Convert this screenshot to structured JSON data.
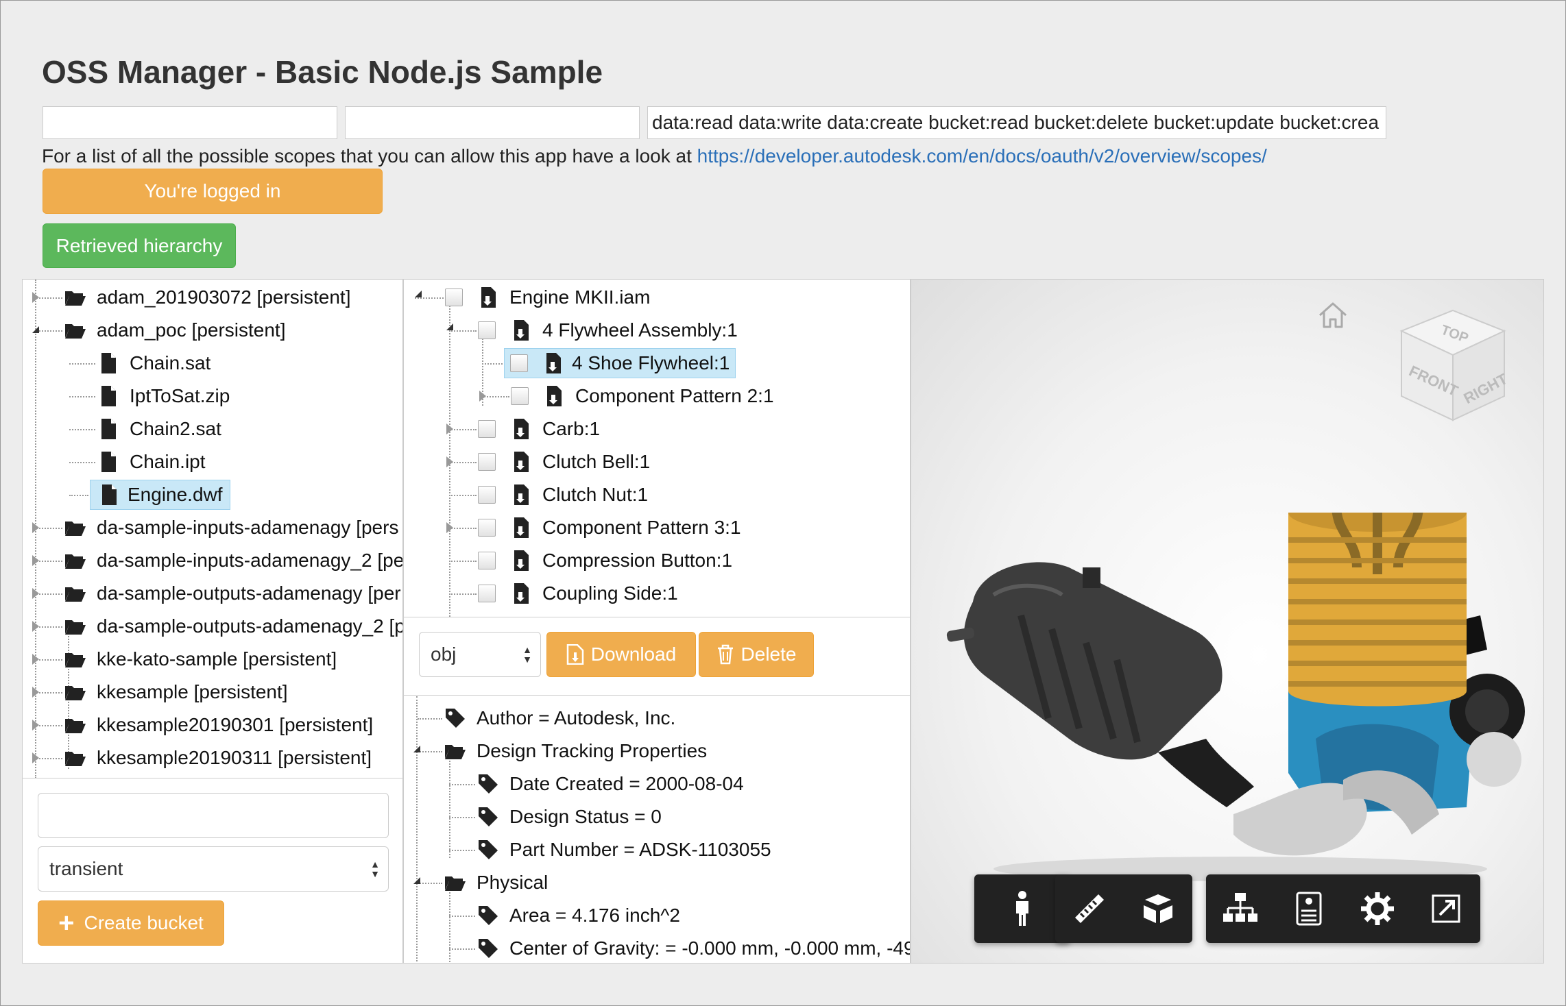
{
  "header": {
    "title": "OSS Manager - Basic Node.js Sample",
    "client_id": "",
    "client_secret": "",
    "scopes": "data:read data:write data:create bucket:read bucket:delete bucket:update bucket:crea",
    "scopes_note": "For a list of all the possible scopes that you can allow this app have a look at ",
    "scopes_link": "https://developer.autodesk.com/en/docs/oauth/v2/overview/scopes/",
    "login_label": "You're logged in",
    "hierarchy_label": "Retrieved hierarchy"
  },
  "buckets": {
    "items": [
      {
        "label": "adam_201903072 [persistent]"
      },
      {
        "label": "adam_poc [persistent]"
      },
      {
        "label": "Chain.sat"
      },
      {
        "label": "IptToSat.zip"
      },
      {
        "label": "Chain2.sat"
      },
      {
        "label": "Chain.ipt"
      },
      {
        "label": "Engine.dwf"
      },
      {
        "label": "da-sample-inputs-adamenagy [pers"
      },
      {
        "label": "da-sample-inputs-adamenagy_2 [pe"
      },
      {
        "label": "da-sample-outputs-adamenagy [per"
      },
      {
        "label": "da-sample-outputs-adamenagy_2 [p"
      },
      {
        "label": "kke-kato-sample [persistent]"
      },
      {
        "label": "kkesample [persistent]"
      },
      {
        "label": "kkesample20190301 [persistent]"
      },
      {
        "label": "kkesample20190311 [persistent]"
      }
    ],
    "new_bucket_name": "",
    "policy_value": "transient",
    "create_label": "Create bucket"
  },
  "hierarchy": {
    "items": [
      {
        "label": "Engine MKII.iam"
      },
      {
        "label": "4 Flywheel Assembly:1"
      },
      {
        "label": "4 Shoe Flywheel:1"
      },
      {
        "label": "Component Pattern 2:1"
      },
      {
        "label": "Carb:1"
      },
      {
        "label": "Clutch Bell:1"
      },
      {
        "label": "Clutch Nut:1"
      },
      {
        "label": "Component Pattern 3:1"
      },
      {
        "label": "Compression Button:1"
      },
      {
        "label": "Coupling Side:1"
      }
    ],
    "format_value": "obj",
    "download_label": "Download",
    "delete_label": "Delete"
  },
  "properties": {
    "items": [
      {
        "label": "Author = Autodesk, Inc."
      },
      {
        "label": "Design Tracking Properties"
      },
      {
        "label": "Date Created = 2000-08-04"
      },
      {
        "label": "Design Status = 0"
      },
      {
        "label": "Part Number = ADSK-1103055"
      },
      {
        "label": "Physical"
      },
      {
        "label": "Area = 4.176 inch^2"
      },
      {
        "label": "Center of Gravity: = -0.000 mm, -0.000 mm, -49"
      }
    ]
  },
  "viewer": {
    "viewcube": {
      "top": "TOP",
      "front": "FRONT",
      "right": "RIGHT"
    },
    "colors": {
      "engine_head": "#e0a83a",
      "engine_block": "#2a8fc0",
      "muffler": "#3a3a3a",
      "toolbar": "#222222"
    }
  }
}
